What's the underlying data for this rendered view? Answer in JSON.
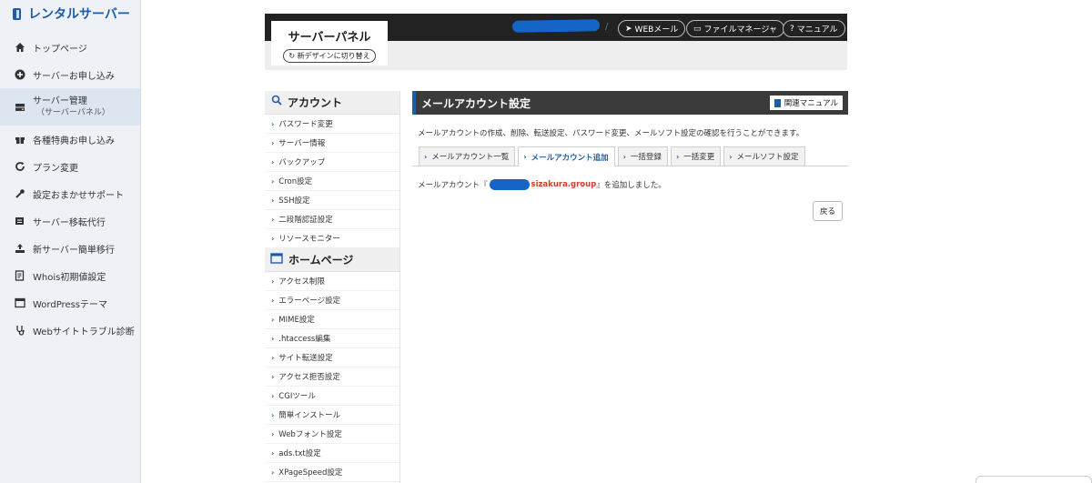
{
  "app": {
    "brand": "レンタルサーバー",
    "nav": [
      {
        "label": "トップページ",
        "icon": "home-icon"
      },
      {
        "label": "サーバーお申し込み",
        "icon": "plus-circle-icon"
      },
      {
        "label": "サーバー管理",
        "sub": "（サーバーパネル）",
        "icon": "server-icon",
        "active": true
      },
      {
        "label": "各種特典お申し込み",
        "icon": "gift-icon"
      },
      {
        "label": "プラン変更",
        "icon": "refresh-icon"
      },
      {
        "label": "設定おまかせサポート",
        "icon": "wrench-icon"
      },
      {
        "label": "サーバー移転代行",
        "icon": "server-move-icon"
      },
      {
        "label": "新サーバー簡単移行",
        "icon": "upload-icon"
      },
      {
        "label": "Whois初期値設定",
        "icon": "document-icon"
      },
      {
        "label": "WordPressテーマ",
        "icon": "window-icon"
      },
      {
        "label": "Webサイトトラブル診断",
        "icon": "stethoscope-icon"
      }
    ]
  },
  "panel": {
    "title": "サーバーパネル",
    "switch_label": "新デザインに切り替え",
    "header_buttons": {
      "webmail": "WEBメール",
      "file_manager": "ファイルマネージャ",
      "manual": "マニュアル"
    }
  },
  "menu": {
    "account_heading": "アカウント",
    "account_links": [
      "パスワード変更",
      "サーバー情報",
      "バックアップ",
      "Cron設定",
      "SSH設定",
      "二段階認証設定",
      "リソースモニター"
    ],
    "homepage_heading": "ホームページ",
    "homepage_links": [
      "アクセス制限",
      "エラーページ設定",
      "MIME設定",
      ".htaccess編集",
      "サイト転送設定",
      "アクセス拒否設定",
      "CGIツール",
      "簡単インストール",
      "Webフォント設定",
      "ads.txt設定",
      "XPageSpeed設定"
    ]
  },
  "content": {
    "title": "メールアカウント設定",
    "manual_button": "関連マニュアル",
    "description": "メールアカウントの作成、削除、転送設定、パスワード変更、メールソフト設定の確認を行うことができます。",
    "tabs": [
      "メールアカウント一覧",
      "メールアカウント追加",
      "一括登録",
      "一括変更",
      "メールソフト設定"
    ],
    "active_tab": 1,
    "result_prefix": "メールアカウント『",
    "result_account_suffix": "sizakura.group",
    "result_postfix": "』を追加しました。",
    "back_button": "戻る"
  },
  "colors": {
    "accent": "#1f5ca8",
    "header_dark": "#222222",
    "highlight_red": "#d0402a"
  }
}
